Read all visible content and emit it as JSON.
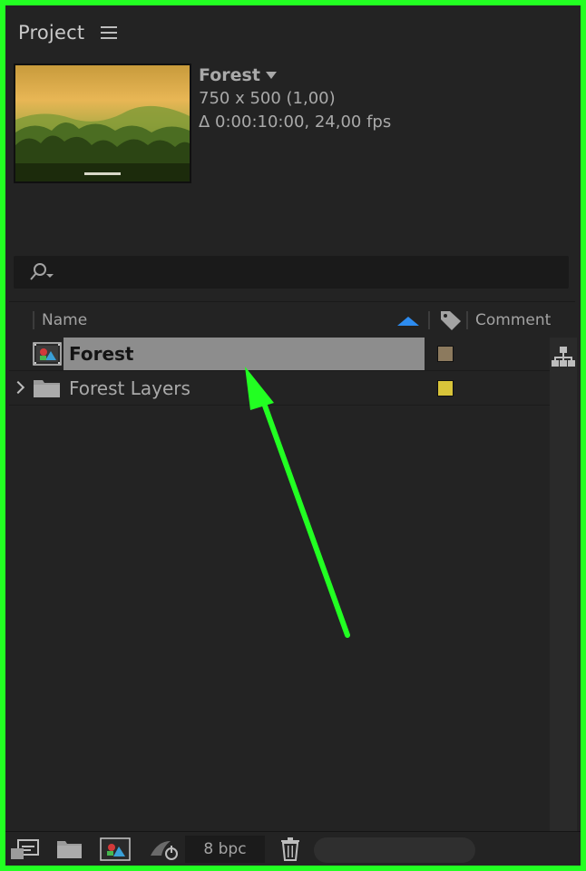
{
  "panel": {
    "title": "Project"
  },
  "preview": {
    "name": "Forest",
    "dimensions": "750 x 500 (1,00)",
    "duration": "Δ 0:00:10:00, 24,00 fps"
  },
  "columns": {
    "name": "Name",
    "comment": "Comment"
  },
  "items": [
    {
      "label": "Forest",
      "type": "composition",
      "label_color": "#8c7a5e",
      "selected": true
    },
    {
      "label": "Forest Layers",
      "type": "folder",
      "label_color": "#d8c43a",
      "selected": false
    }
  ],
  "toolbar": {
    "bit_depth": "8 bpc"
  },
  "colors": {
    "annotation": "#22ff22",
    "sort_arrow": "#2d8cf0",
    "selection": "#8d8d8d"
  }
}
